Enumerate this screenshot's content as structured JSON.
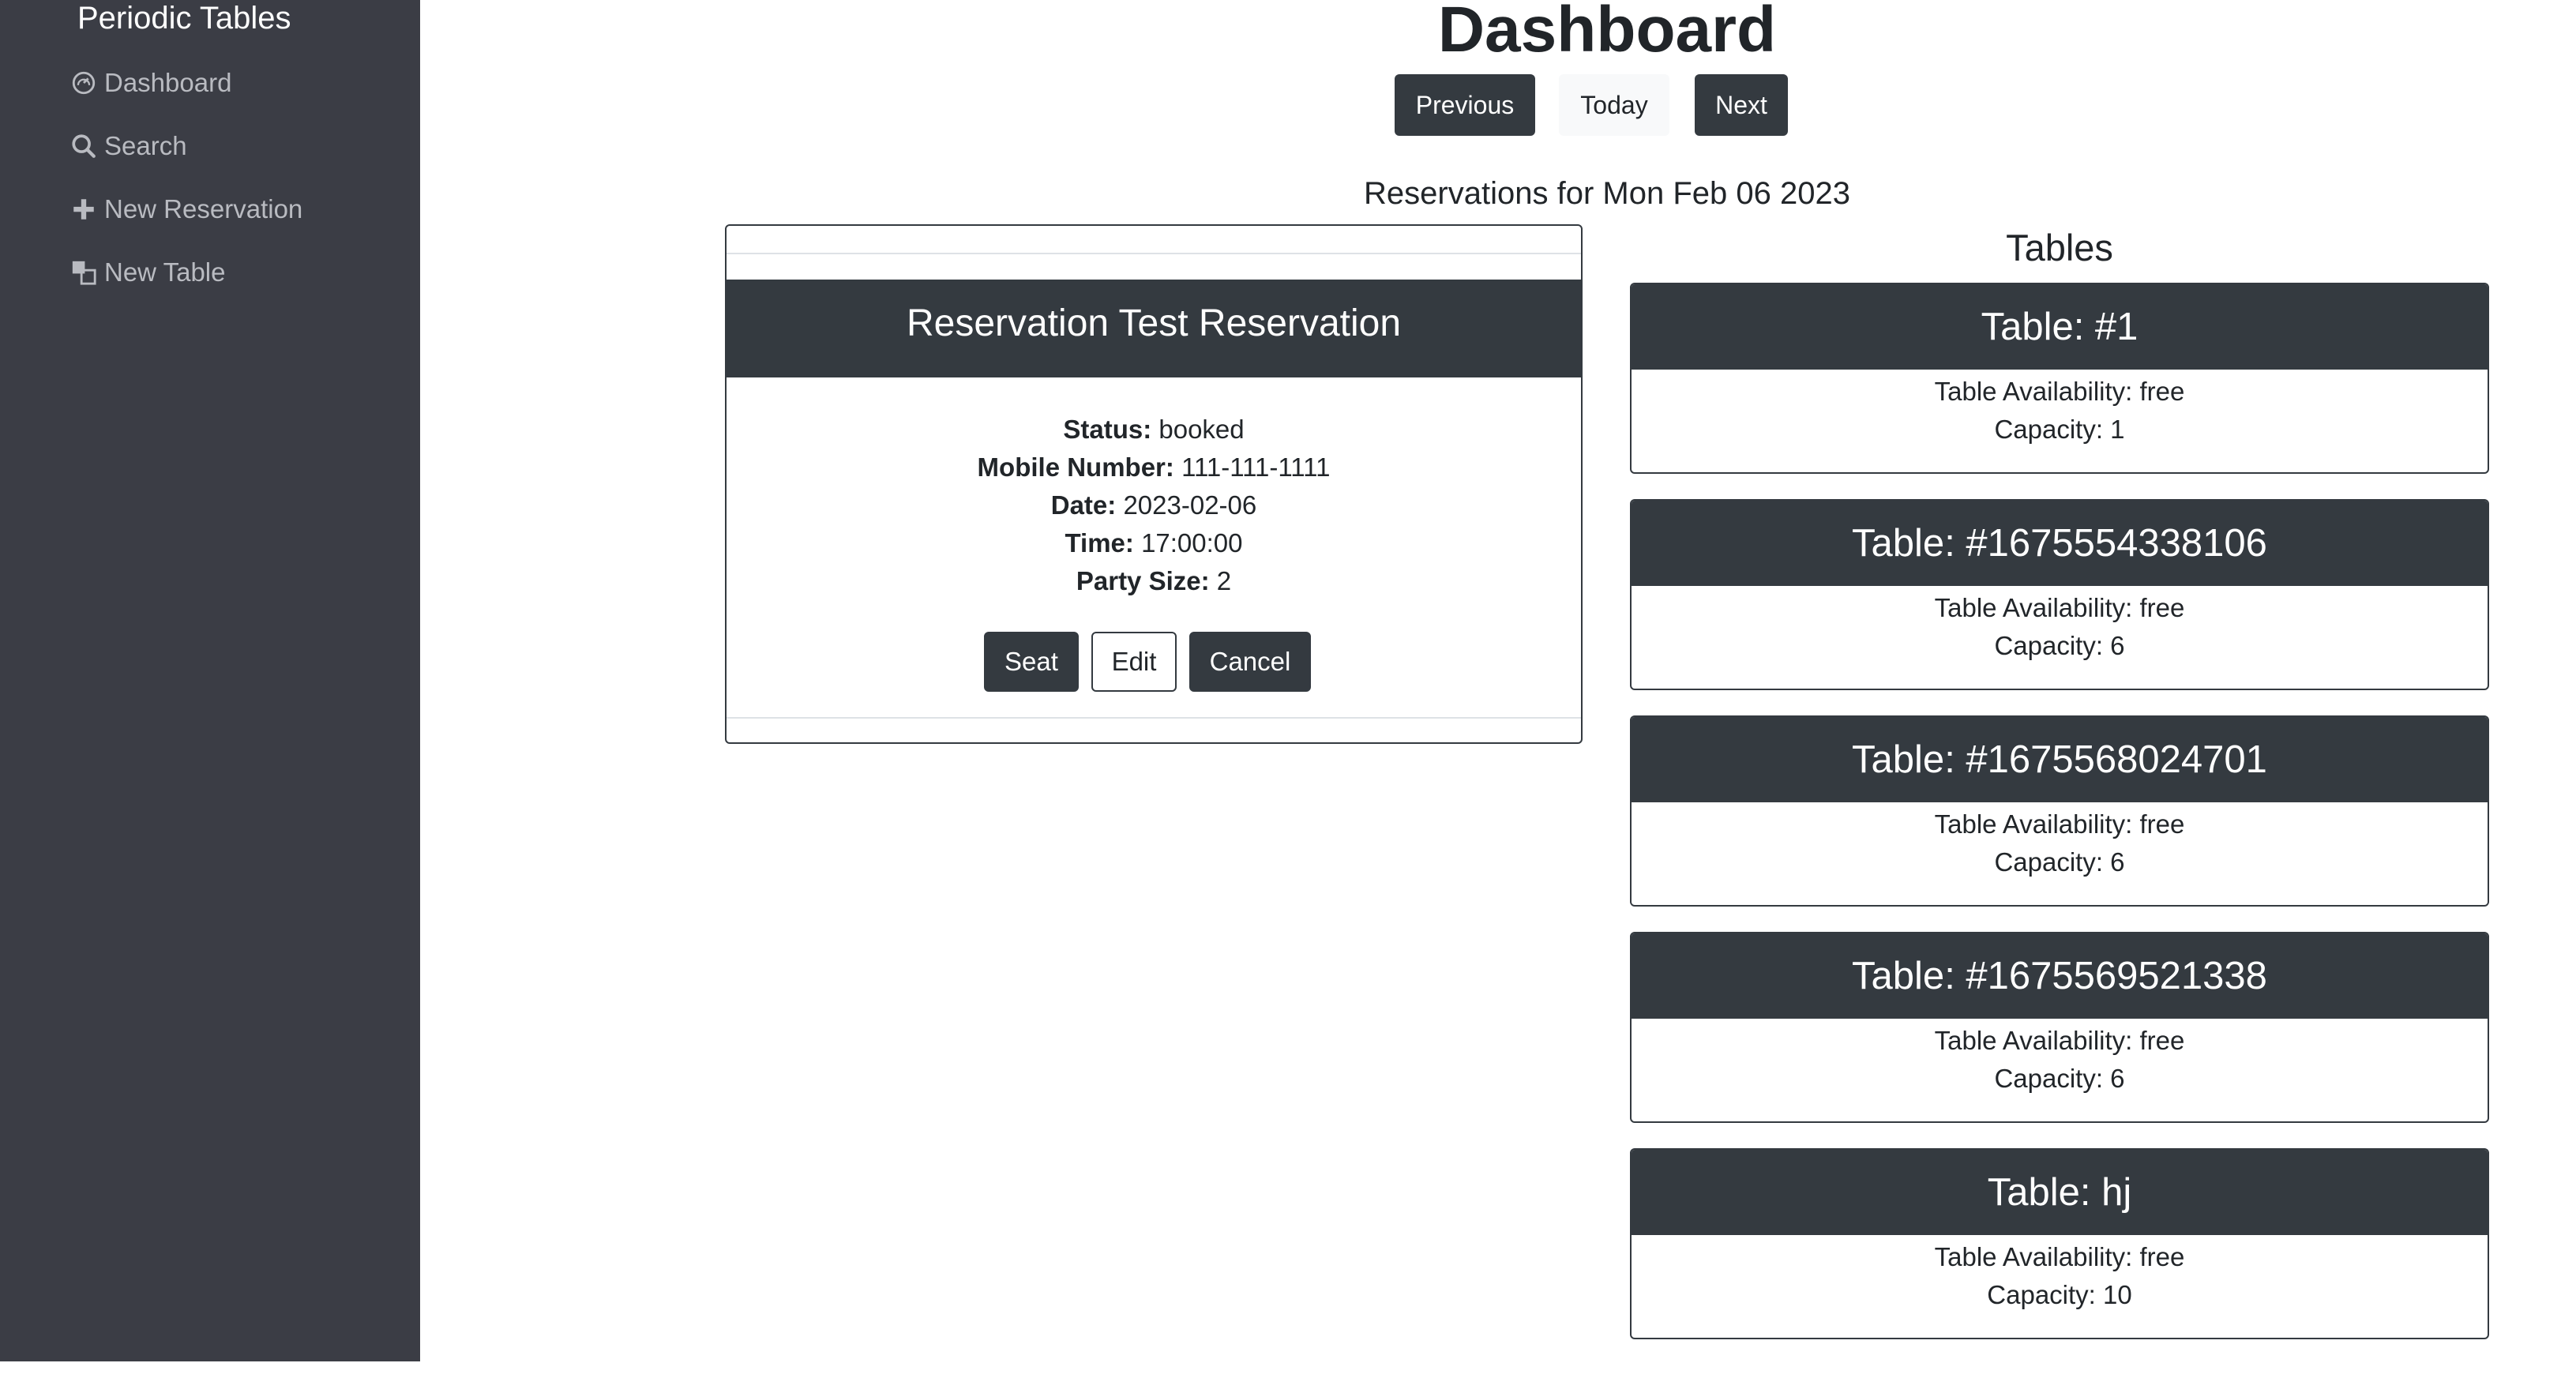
{
  "sidebar": {
    "brand": "Periodic Tables",
    "items": [
      {
        "label": "Dashboard",
        "icon": "dashboard-icon"
      },
      {
        "label": "Search",
        "icon": "search-icon"
      },
      {
        "label": "New Reservation",
        "icon": "plus-icon"
      },
      {
        "label": "New Table",
        "icon": "table-icon"
      }
    ]
  },
  "header": {
    "title": "Dashboard",
    "previous_label": "Previous",
    "today_label": "Today",
    "next_label": "Next",
    "reservations_date": "Reservations for Mon Feb 06 2023"
  },
  "reservation": {
    "title": "Reservation Test Reservation",
    "fields": [
      {
        "label": "Status:",
        "value": "booked"
      },
      {
        "label": "Mobile Number:",
        "value": "111-111-1111"
      },
      {
        "label": "Date:",
        "value": "2023-02-06"
      },
      {
        "label": "Time:",
        "value": "17:00:00"
      },
      {
        "label": "Party Size:",
        "value": "2"
      }
    ],
    "seat_label": "Seat",
    "edit_label": "Edit",
    "cancel_label": "Cancel"
  },
  "tables_section": {
    "title": "Tables",
    "tables": [
      {
        "name": "Table: #1",
        "availability": "Table Availability: free",
        "capacity": "Capacity: 1"
      },
      {
        "name": "Table: #1675554338106",
        "availability": "Table Availability: free",
        "capacity": "Capacity: 6"
      },
      {
        "name": "Table: #1675568024701",
        "availability": "Table Availability: free",
        "capacity": "Capacity: 6"
      },
      {
        "name": "Table: #1675569521338",
        "availability": "Table Availability: free",
        "capacity": "Capacity: 6"
      },
      {
        "name": "Table: hj",
        "availability": "Table Availability: free",
        "capacity": "Capacity: 10"
      }
    ]
  },
  "colors": {
    "sidebar_bg": "#3b3d45",
    "dark": "#343a40",
    "light_button": "#f8f9fa",
    "nav_text": "#b9bbc1"
  }
}
